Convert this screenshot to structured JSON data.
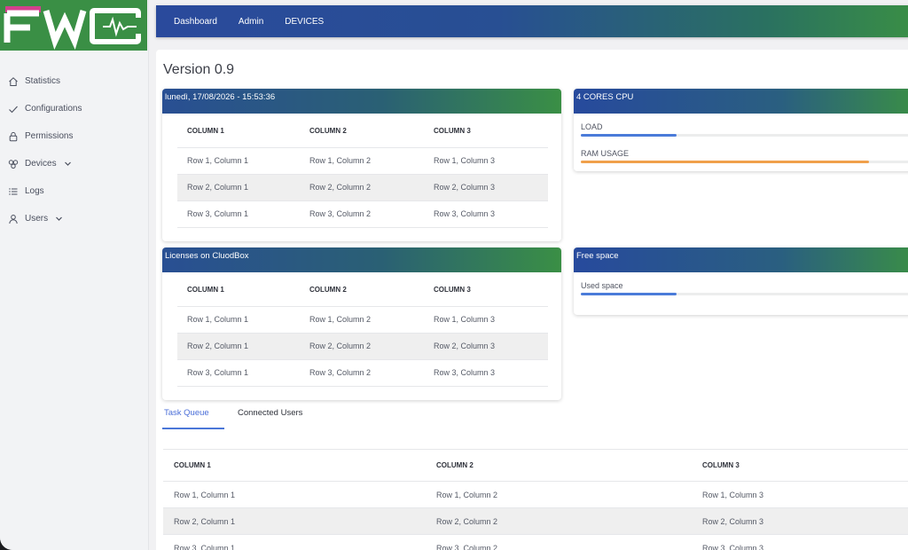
{
  "logo": {
    "text": "FWC"
  },
  "sidebar": {
    "items": [
      {
        "label": "Statistics"
      },
      {
        "label": "Configurations"
      },
      {
        "label": "Permissions"
      },
      {
        "label": "Devices"
      },
      {
        "label": "Logs"
      },
      {
        "label": "Users"
      }
    ]
  },
  "topbar": {
    "links": [
      "Dashboard",
      "Admin",
      "DEVICES"
    ]
  },
  "main": {
    "version": "Version 0.9",
    "datetime_card": {
      "title": "lunedì, 17/08/2026 - 15:53:36",
      "headers": [
        "COLUMN 1",
        "COLUMN 2",
        "COLUMN 3"
      ],
      "rows": [
        [
          "Row 1, Column 1",
          "Row 1, Column 2",
          "Row 1, Column 3"
        ],
        [
          "Row 2, Column 1",
          "Row 2, Column 2",
          "Row 2, Column 3"
        ],
        [
          "Row 3, Column 1",
          "Row 3, Column 2",
          "Row 3, Column 3"
        ]
      ]
    },
    "cpu_card": {
      "title": "4 CORES CPU",
      "load_label": "LOAD",
      "load_value": 0.285,
      "ram_label": "RAM USAGE",
      "ram_value": 0.855
    },
    "licenses_card": {
      "title": "Licenses on CluodBox",
      "headers": [
        "COLUMN 1",
        "COLUMN 2",
        "COLUMN 3"
      ],
      "rows": [
        [
          "Row 1, Column 1",
          "Row 1, Column 2",
          "Row 1, Column 3"
        ],
        [
          "Row 2, Column 1",
          "Row 2, Column 2",
          "Row 2, Column 3"
        ],
        [
          "Row 3, Column 1",
          "Row 3, Column 2",
          "Row 3, Column 3"
        ]
      ]
    },
    "free_space_card": {
      "title": "Free space",
      "used_label": "Used space",
      "used_value": 0.285
    },
    "tabs": [
      "Task Queue",
      "Connected Users"
    ],
    "queue_table": {
      "headers": [
        "COLUMN 1",
        "COLUMN 2",
        "COLUMN 3"
      ],
      "rows": [
        [
          "Row 1, Column 1",
          "Row 1, Column 2",
          "Row 1, Column 3"
        ],
        [
          "Row 2, Column 1",
          "Row 2, Column 2",
          "Row 2, Column 3"
        ],
        [
          "Row 3, Column 1",
          "Row 3, Column 2",
          "Row 3, Column 3"
        ]
      ]
    }
  },
  "colors": {
    "brand_green": "#3a8f45",
    "brand_blue": "#284f93",
    "load_bar": "#4a7bd9",
    "ram_bar": "#f0a04b",
    "used_bar": "#4a7bd9",
    "tab_active": "#4a6ed8"
  },
  "icons": [
    "home-icon",
    "check-icon",
    "lock-icon",
    "devices-icon",
    "list-icon",
    "user-icon",
    "chevron-down-icon"
  ]
}
